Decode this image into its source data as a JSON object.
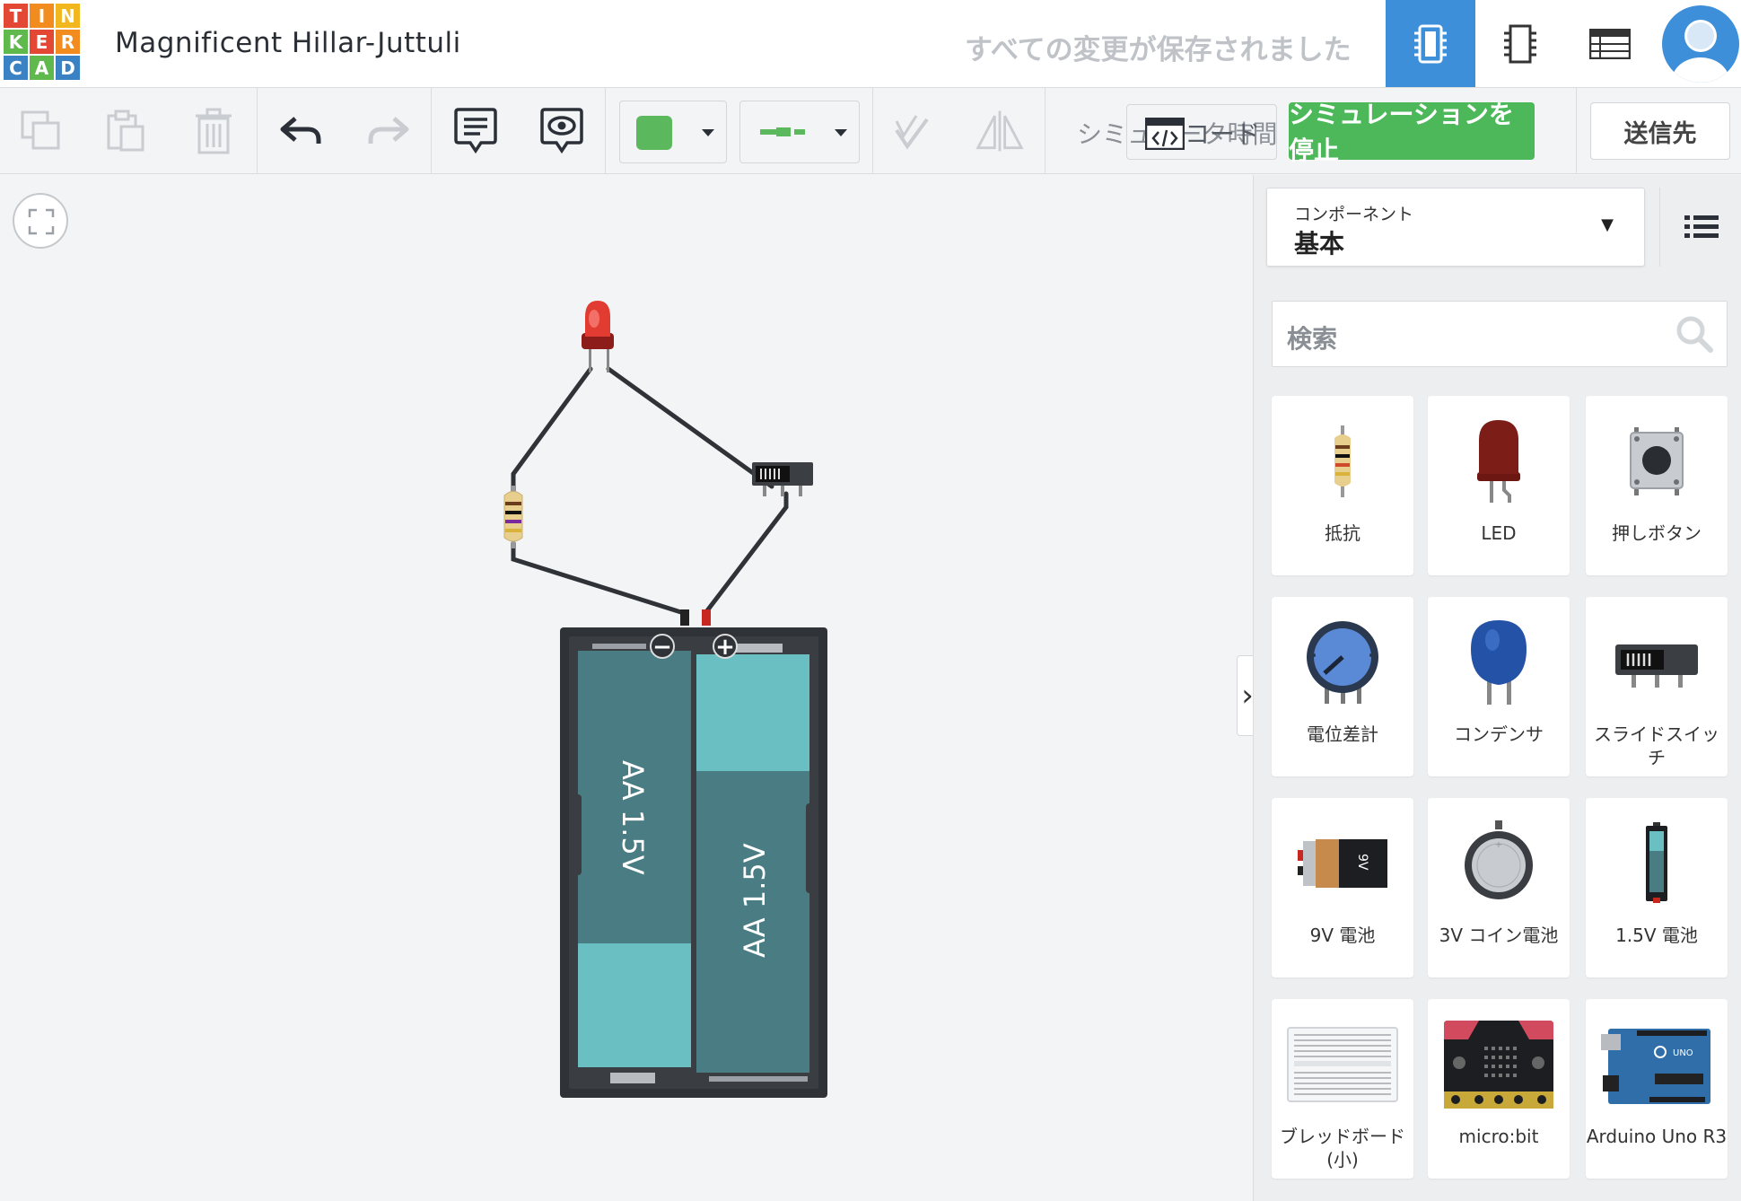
{
  "header": {
    "logo_letters": [
      "T",
      "I",
      "N",
      "K",
      "E",
      "R",
      "C",
      "A",
      "D"
    ],
    "logo_colors": [
      "#e24834",
      "#f28c1e",
      "#f2b61e",
      "#5fb94c",
      "#e24834",
      "#f28c1e",
      "#3b82c4",
      "#5fb94c",
      "#3b82c4"
    ],
    "project_title": "Magnificent Hillar-Juttuli",
    "save_status": "すべての変更が保存されました",
    "views": [
      "circuit-view",
      "schematic-view",
      "component-list-view"
    ],
    "accent_color": "#3e8fd9"
  },
  "toolbar": {
    "icons": [
      "copy-icon",
      "paste-icon",
      "delete-icon",
      "undo-icon",
      "redo-icon",
      "note-icon",
      "toggle-notes-icon",
      "color-dropdown",
      "wire-style-dropdown",
      "rotate-icon",
      "flip-icon"
    ],
    "wire_color": "#5cb85c",
    "code_label": "シミュレータ時間",
    "code_button_label": "コード",
    "stop_sim_label": "シミュレーションを停止",
    "stop_sim_color": "#4cb85a",
    "send_to_label": "送信先"
  },
  "canvas": {
    "battery_labels": [
      "AA 1.5V",
      "AA 1.5V"
    ],
    "terminal_minus": "−",
    "terminal_plus": "+"
  },
  "panel": {
    "select_label": "コンポーネント",
    "select_value": "基本",
    "search_placeholder": "検索",
    "components": [
      {
        "label": "抵抗",
        "icon": "resistor-icon"
      },
      {
        "label": "LED",
        "icon": "led-icon"
      },
      {
        "label": "押しボタン",
        "icon": "pushbutton-icon"
      },
      {
        "label": "電位差計",
        "icon": "potentiometer-icon"
      },
      {
        "label": "コンデンサ",
        "icon": "capacitor-icon"
      },
      {
        "label": "スライドスイッチ",
        "icon": "slide-switch-icon"
      },
      {
        "label": "9V 電池",
        "icon": "battery-9v-icon"
      },
      {
        "label": "3V コイン電池",
        "icon": "coin-battery-icon"
      },
      {
        "label": "1.5V 電池",
        "icon": "battery-aa-icon"
      },
      {
        "label": "ブレッドボード (小)",
        "icon": "breadboard-icon"
      },
      {
        "label": "micro:bit",
        "icon": "microbit-icon"
      },
      {
        "label": "Arduino Uno R3",
        "icon": "arduino-icon"
      }
    ]
  }
}
